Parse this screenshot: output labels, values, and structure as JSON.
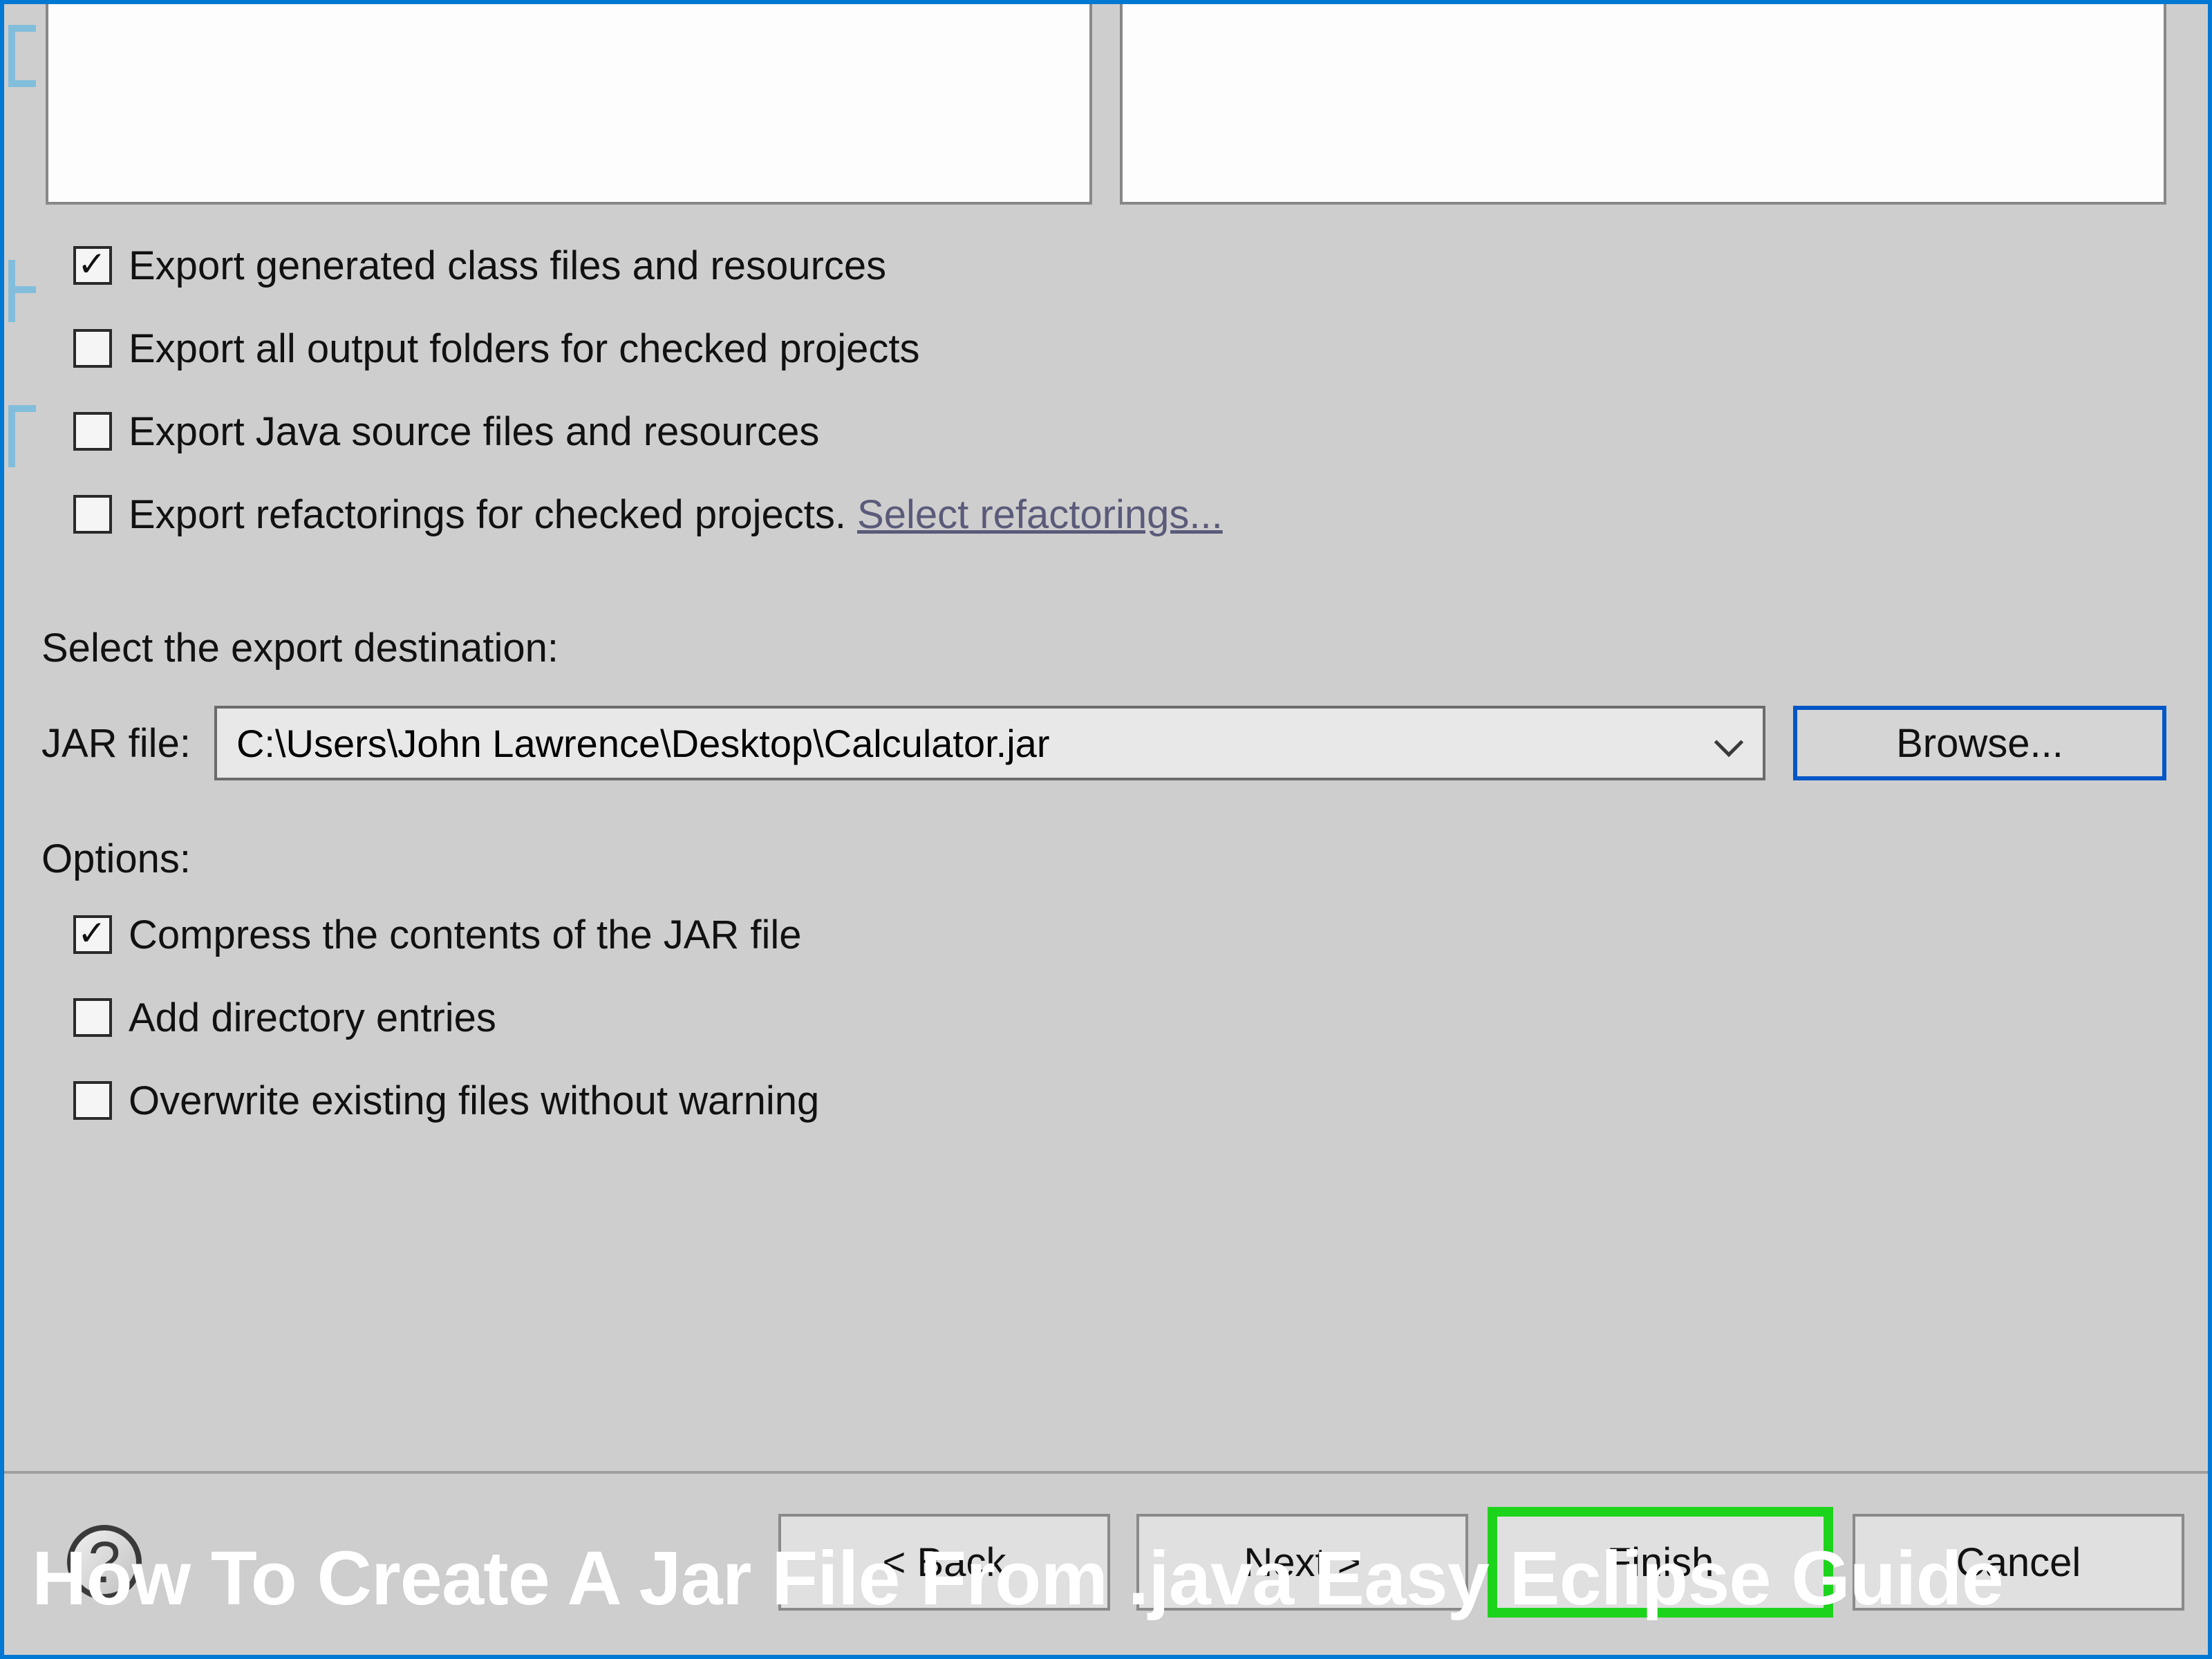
{
  "export": {
    "checkboxes": [
      {
        "label": "Export generated class files and resources",
        "checked": true
      },
      {
        "label": "Export all output folders for checked projects",
        "checked": false
      },
      {
        "label": "Export Java source files and resources",
        "checked": false
      },
      {
        "label": "Export refactorings for checked projects.",
        "checked": false
      }
    ],
    "refactorings_link": "Select refactorings..."
  },
  "destination": {
    "section_label": "Select the export destination:",
    "jar_label": "JAR file:",
    "jar_path": "C:\\Users\\John Lawrence\\Desktop\\Calculator.jar",
    "browse_label": "Browse..."
  },
  "options": {
    "section_label": "Options:",
    "checkboxes": [
      {
        "label": "Compress the contents of the JAR file",
        "checked": true
      },
      {
        "label": "Add directory entries",
        "checked": false
      },
      {
        "label": "Overwrite existing files without warning",
        "checked": false
      }
    ]
  },
  "footer": {
    "help": "?",
    "back": "< Back",
    "next": "Next >",
    "finish": "Finish",
    "cancel": "Cancel"
  },
  "caption": "How To Create A Jar File From .java Easy Eclipse Guide"
}
